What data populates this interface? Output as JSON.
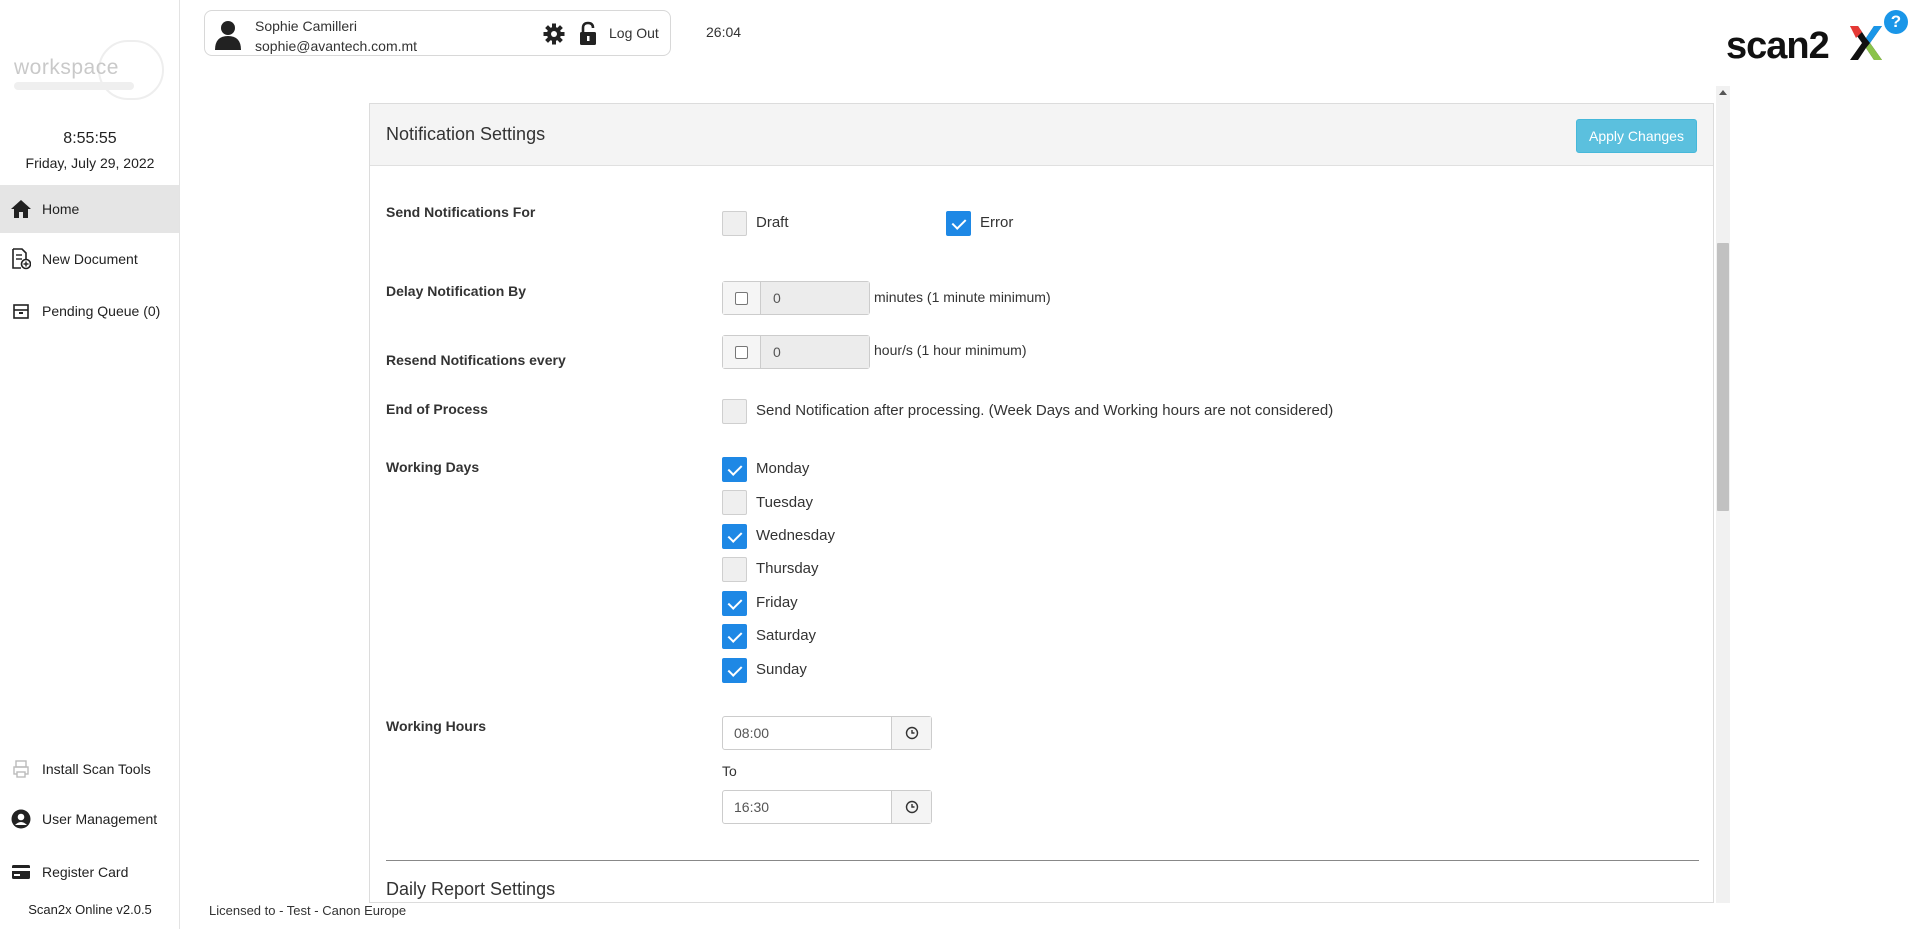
{
  "sidebar": {
    "logo_text": "workspace",
    "clock_time": "8:55:55",
    "clock_date": "Friday, July 29, 2022",
    "nav": [
      {
        "label": "Home",
        "icon": "home-icon"
      },
      {
        "label": "New Document",
        "icon": "new-document-icon"
      },
      {
        "label": "Pending Queue (0)",
        "icon": "inbox-icon"
      },
      {
        "label": "Install Scan Tools",
        "icon": "printer-icon"
      },
      {
        "label": "User Management",
        "icon": "user-circle-icon"
      },
      {
        "label": "Register Card",
        "icon": "card-icon"
      }
    ],
    "version": "Scan2x Online v2.0.5"
  },
  "header": {
    "user_name": "Sophie Camilleri",
    "user_email": "sophie@avantech.com.mt",
    "logout_label": "Log Out",
    "session_timer": "26:04",
    "brand_text": "scan2",
    "help_label": "?"
  },
  "panel": {
    "title": "Notification Settings",
    "apply_label": "Apply Changes",
    "send_for_label": "Send Notifications For",
    "draft_label": "Draft",
    "draft_checked": false,
    "error_label": "Error",
    "error_checked": true,
    "delay_label": "Delay Notification By",
    "delay_value": "0",
    "delay_unit": "minutes (1 minute minimum)",
    "resend_label": "Resend Notifications every",
    "resend_value": "0",
    "resend_unit": "hour/s (1 hour minimum)",
    "eop_label": "End of Process",
    "eop_text": "Send Notification after processing. (Week Days and Working hours are not considered)",
    "eop_checked": false,
    "working_days_label": "Working Days",
    "days": [
      {
        "label": "Monday",
        "checked": true
      },
      {
        "label": "Tuesday",
        "checked": false
      },
      {
        "label": "Wednesday",
        "checked": true
      },
      {
        "label": "Thursday",
        "checked": false
      },
      {
        "label": "Friday",
        "checked": true
      },
      {
        "label": "Saturday",
        "checked": true
      },
      {
        "label": "Sunday",
        "checked": true
      }
    ],
    "working_hours_label": "Working Hours",
    "from_time": "08:00",
    "to_label": "To",
    "to_time": "16:30",
    "daily_report_title": "Daily Report Settings"
  },
  "footer": {
    "license": "Licensed to - Test - Canon Europe"
  },
  "colors": {
    "accent": "#1e88e5",
    "apply_button": "#5bc0de",
    "help": "#1a96e8"
  }
}
